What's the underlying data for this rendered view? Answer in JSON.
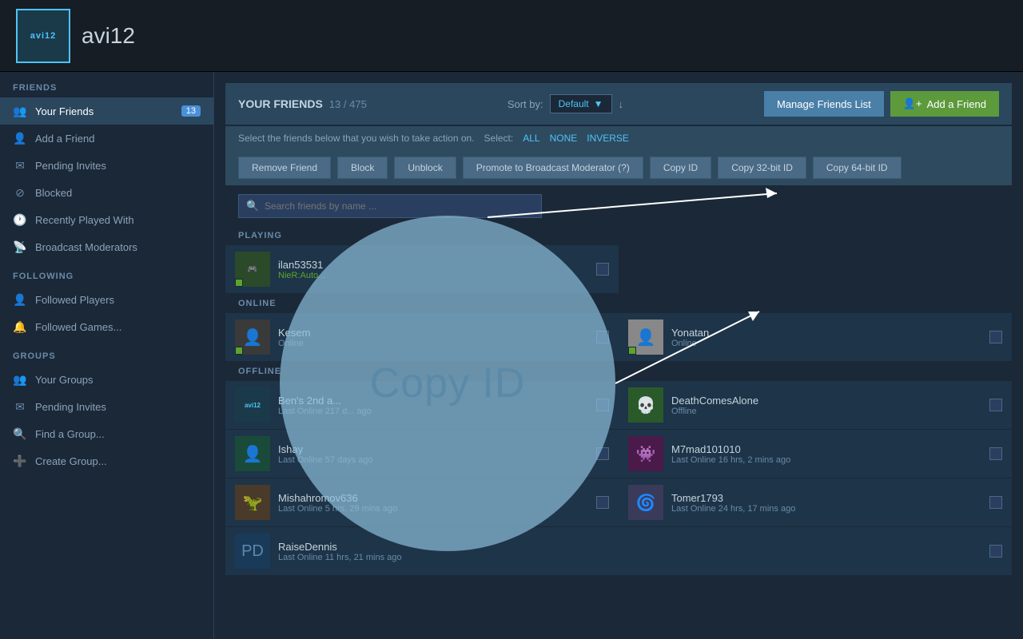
{
  "topbar": {
    "avatar_text": "avi12",
    "username": "avi12"
  },
  "sidebar": {
    "friends_section": "FRIENDS",
    "following_section": "FOLLOWING",
    "groups_section": "GROUPS",
    "items": {
      "your_friends": "Your Friends",
      "your_friends_badge": "13",
      "add_friend": "Add a Friend",
      "pending_invites": "Pending Invites",
      "blocked": "Blocked",
      "recently_played": "Recently Played With",
      "broadcast_mods": "Broadcast Moderators",
      "followed_players": "Followed Players",
      "followed_games": "Followed Games...",
      "your_groups": "Your Groups",
      "pending_invites_groups": "Pending Invites",
      "find_group": "Find a Group...",
      "create_group": "Create Group..."
    }
  },
  "friends_panel": {
    "title": "YOUR FRIENDS",
    "count": "13",
    "separator": "/",
    "total": "475",
    "sort_label": "Sort by:",
    "sort_value": "Default",
    "manage_btn": "Manage Friends List",
    "add_friend_btn": "Add a Friend",
    "select_instruction": "Select the friends below that you wish to take action on.",
    "select_label": "Select:",
    "select_all": "ALL",
    "select_none": "NONE",
    "select_inverse": "INVERSE"
  },
  "action_buttons": {
    "remove_friend": "Remove Friend",
    "block": "Block",
    "unblock": "Unblock",
    "promote": "Promote to Broadcast Moderator (?)",
    "copy_id": "Copy ID",
    "copy_32bit": "Copy 32-bit ID",
    "copy_64bit": "Copy 64-bit ID"
  },
  "search": {
    "placeholder": "Search friends by name ..."
  },
  "sections": {
    "playing": "PLAYING",
    "online": "ONLINE",
    "offline": "OFFLINE"
  },
  "friends": [
    {
      "id": "f1",
      "name": "ilan53531",
      "status": "NieR:Auto...",
      "state": "playing",
      "col": "left",
      "avatar_color": "#2a4a2a"
    },
    {
      "id": "f2",
      "name": "Kesem",
      "status": "Online",
      "state": "online",
      "col": "left",
      "avatar_color": "#3a3a3a"
    },
    {
      "id": "f3",
      "name": "Yonatan",
      "status": "Online",
      "state": "online",
      "col": "right",
      "avatar_color": "#888"
    },
    {
      "id": "f4",
      "name": "Ben's 2nd a...",
      "status": "Last Online 217 d... ago",
      "state": "offline",
      "col": "left",
      "avatar_color": "#1a3a4a"
    },
    {
      "id": "f5",
      "name": "DeathComesAlone",
      "status": "Offline",
      "state": "offline",
      "col": "right",
      "avatar_color": "#2a5a2a"
    },
    {
      "id": "f6",
      "name": "Ishay",
      "status": "Last Online 57 days ago",
      "state": "offline",
      "col": "left",
      "avatar_color": "#1a4a3a"
    },
    {
      "id": "f7",
      "name": "M7mad101010",
      "status": "Last Online 16 hrs, 2 mins ago",
      "state": "offline",
      "col": "right",
      "avatar_color": "#4a1a4a"
    },
    {
      "id": "f8",
      "name": "Mishahromov636",
      "status": "Last Online 5 hrs, 29 mins ago",
      "state": "offline",
      "col": "left",
      "avatar_color": "#4a3a2a"
    },
    {
      "id": "f9",
      "name": "RaiseDennis",
      "status": "Last Online 11 hrs, 21 mins ago",
      "state": "offline",
      "col": "left",
      "avatar_color": "#1a3a5a"
    },
    {
      "id": "f10",
      "name": "Tomer1793",
      "status": "Last Online 24 hrs, 17 mins ago",
      "state": "offline",
      "col": "right",
      "avatar_color": "#3a3a5a"
    }
  ],
  "copy_id_overlay": {
    "label": "Copy ID"
  }
}
